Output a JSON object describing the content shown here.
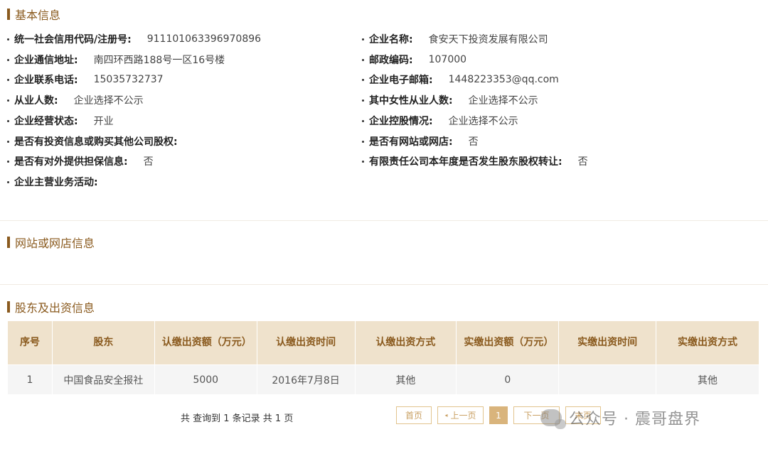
{
  "basic": {
    "title": "基本信息",
    "left": [
      {
        "label": "统一社会信用代码/注册号:",
        "value": "911101063396970896"
      },
      {
        "label": "企业通信地址:",
        "value": "南四环西路188号一区16号楼"
      },
      {
        "label": "企业联系电话:",
        "value": "15035732737"
      },
      {
        "label": "从业人数:",
        "value": "企业选择不公示"
      },
      {
        "label": "企业经营状态:",
        "value": "开业"
      },
      {
        "label": "是否有投资信息或购买其他公司股权:",
        "value": ""
      },
      {
        "label": "是否有对外提供担保信息:",
        "value": "否"
      },
      {
        "label": "企业主营业务活动:",
        "value": ""
      }
    ],
    "right": [
      {
        "label": "企业名称:",
        "value": "食安天下投资发展有限公司"
      },
      {
        "label": "邮政编码:",
        "value": "107000"
      },
      {
        "label": "企业电子邮箱:",
        "value": "1448223353@qq.com"
      },
      {
        "label": "其中女性从业人数:",
        "value": "企业选择不公示"
      },
      {
        "label": "企业控股情况:",
        "value": "企业选择不公示"
      },
      {
        "label": "是否有网站或网店:",
        "value": "否"
      },
      {
        "label": "有限责任公司本年度是否发生股东股权转让:",
        "value": "否"
      }
    ]
  },
  "website": {
    "title": "网站或网店信息"
  },
  "shareholders": {
    "title": "股东及出资信息",
    "headers": [
      "序号",
      "股东",
      "认缴出资额（万元）",
      "认缴出资时间",
      "认缴出资方式",
      "实缴出资额（万元）",
      "实缴出资时间",
      "实缴出资方式"
    ],
    "rows": [
      [
        "1",
        "中国食品安全报社",
        "5000",
        "2016年7月8日",
        "其他",
        "0",
        "",
        "其他"
      ]
    ]
  },
  "pagination": {
    "summary": "共 查询到 1 条记录 共 1 页",
    "first": "首页",
    "prev": "上一页",
    "prev_icon": "caret-left-icon",
    "current": "1",
    "next": "下一页",
    "last": "末页"
  },
  "watermark": {
    "text": "公众号 · 震哥盘界",
    "icon": "wechat-icon"
  },
  "colors": {
    "accent": "#8a5a1e",
    "table_header_bg": "#efe2cc",
    "table_row_bg": "#f5f5f5",
    "pager_border": "#e2c48e",
    "pager_active": "#d9b47c"
  }
}
